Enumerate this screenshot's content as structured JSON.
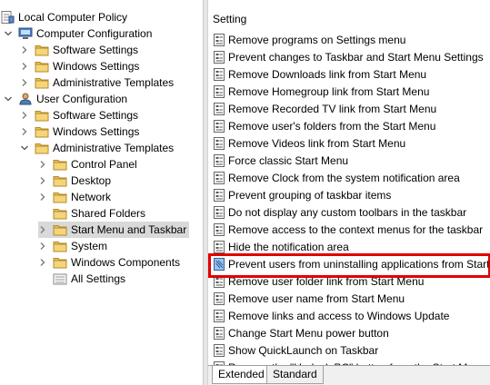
{
  "tree": {
    "items": [
      {
        "label": "Local Computer Policy",
        "icon": "policy-document-icon",
        "level": 0,
        "expander": "none"
      },
      {
        "label": "Computer Configuration",
        "icon": "computer-icon",
        "level": 1,
        "expander": "expanded"
      },
      {
        "label": "Software Settings",
        "icon": "folder-icon",
        "level": 2,
        "expander": "collapsed"
      },
      {
        "label": "Windows Settings",
        "icon": "folder-icon",
        "level": 2,
        "expander": "collapsed"
      },
      {
        "label": "Administrative Templates",
        "icon": "folder-icon",
        "level": 2,
        "expander": "collapsed"
      },
      {
        "label": "User Configuration",
        "icon": "user-icon",
        "level": 1,
        "expander": "expanded"
      },
      {
        "label": "Software Settings",
        "icon": "folder-icon",
        "level": 2,
        "expander": "collapsed"
      },
      {
        "label": "Windows Settings",
        "icon": "folder-icon",
        "level": 2,
        "expander": "collapsed"
      },
      {
        "label": "Administrative Templates",
        "icon": "folder-icon",
        "level": 2,
        "expander": "expanded"
      },
      {
        "label": "Control Panel",
        "icon": "folder-icon",
        "level": 3,
        "expander": "collapsed"
      },
      {
        "label": "Desktop",
        "icon": "folder-icon",
        "level": 3,
        "expander": "collapsed"
      },
      {
        "label": "Network",
        "icon": "folder-icon",
        "level": 3,
        "expander": "collapsed"
      },
      {
        "label": "Shared Folders",
        "icon": "folder-icon",
        "level": 3,
        "expander": "none"
      },
      {
        "label": "Start Menu and Taskbar",
        "icon": "folder-icon",
        "level": 3,
        "expander": "collapsed",
        "selected": true
      },
      {
        "label": "System",
        "icon": "folder-icon",
        "level": 3,
        "expander": "collapsed"
      },
      {
        "label": "Windows Components",
        "icon": "folder-icon",
        "level": 3,
        "expander": "collapsed"
      },
      {
        "label": "All Settings",
        "icon": "all-settings-icon",
        "level": 3,
        "expander": "none"
      }
    ]
  },
  "settings": {
    "column_header": "Setting",
    "items": [
      {
        "label": "Remove programs on Settings menu"
      },
      {
        "label": "Prevent changes to Taskbar and Start Menu Settings"
      },
      {
        "label": "Remove Downloads link from Start Menu"
      },
      {
        "label": "Remove Homegroup link from Start Menu"
      },
      {
        "label": "Remove Recorded TV link from Start Menu"
      },
      {
        "label": "Remove user's folders from the Start Menu"
      },
      {
        "label": "Remove Videos link from Start Menu"
      },
      {
        "label": "Force classic Start Menu"
      },
      {
        "label": "Remove Clock from the system notification area"
      },
      {
        "label": "Prevent grouping of taskbar items"
      },
      {
        "label": "Do not display any custom toolbars in the taskbar"
      },
      {
        "label": "Remove access to the context menus for the taskbar"
      },
      {
        "label": "Hide the notification area"
      },
      {
        "label": "Prevent users from uninstalling applications from Start",
        "highlighted": true
      },
      {
        "label": "Remove user folder link from Start Menu"
      },
      {
        "label": "Remove user name from Start Menu"
      },
      {
        "label": "Remove links and access to Windows Update"
      },
      {
        "label": "Change Start Menu power button"
      },
      {
        "label": "Show QuickLaunch on Taskbar"
      },
      {
        "label": "Remove the \"Undock PC\" button from the Start Menu"
      }
    ]
  },
  "tabs": [
    {
      "label": "Extended"
    },
    {
      "label": "Standard"
    }
  ],
  "colors": {
    "highlight_border": "#e00000",
    "selected_row": "#d9d9d9",
    "folder": "#e8c15a"
  }
}
